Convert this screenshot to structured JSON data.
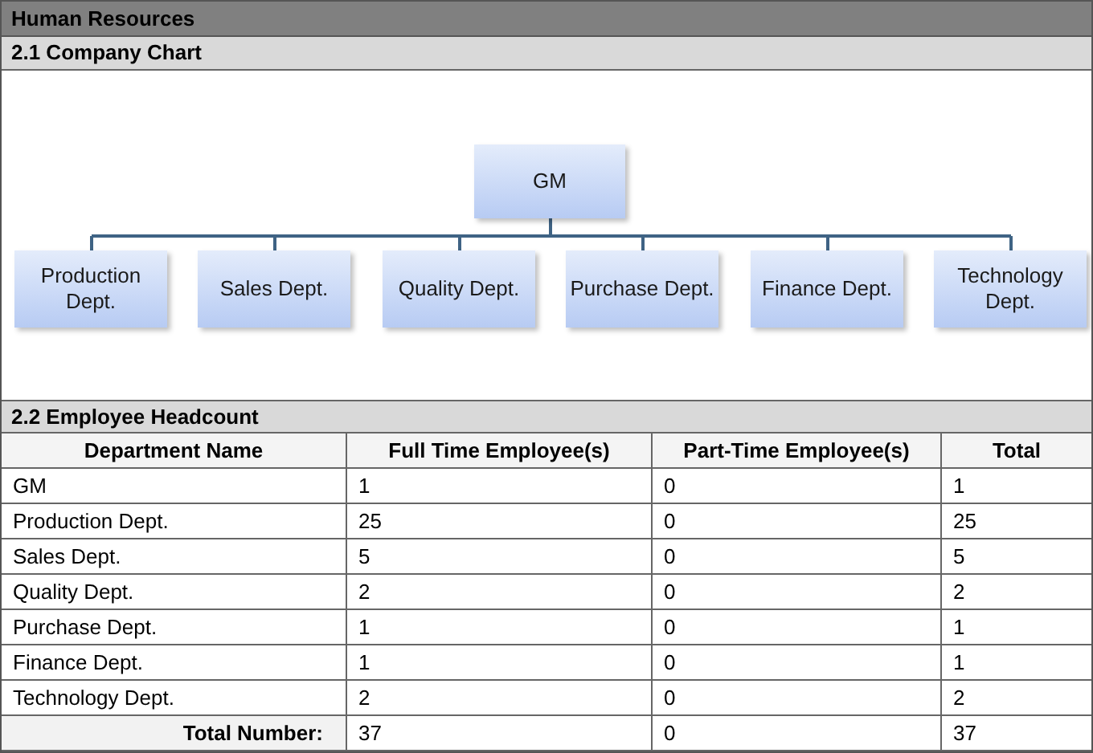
{
  "title": "Human Resources",
  "chart_section": {
    "heading": "2.1 Company Chart",
    "root": {
      "label": "GM",
      "children": [
        {
          "label": "Production Dept."
        },
        {
          "label": "Sales Dept."
        },
        {
          "label": "Quality Dept."
        },
        {
          "label": "Purchase Dept."
        },
        {
          "label": "Finance Dept."
        },
        {
          "label": "Technology Dept."
        }
      ]
    }
  },
  "headcount_section": {
    "heading": "2.2 Employee Headcount",
    "table": {
      "columns": [
        "Department Name",
        "Full Time Employee(s)",
        "Part-Time Employee(s)",
        "Total"
      ],
      "rows": [
        [
          "GM",
          "1",
          "0",
          "1"
        ],
        [
          "Production Dept.",
          "25",
          "0",
          "25"
        ],
        [
          "Sales Dept.",
          "5",
          "0",
          "5"
        ],
        [
          "Quality Dept.",
          "2",
          "0",
          "2"
        ],
        [
          "Purchase Dept.",
          "1",
          "0",
          "1"
        ],
        [
          "Finance Dept.",
          "1",
          "0",
          "1"
        ],
        [
          "Technology Dept.",
          "2",
          "0",
          "2"
        ]
      ],
      "total_row": [
        "Total Number:",
        "37",
        "0",
        "37"
      ]
    }
  }
}
